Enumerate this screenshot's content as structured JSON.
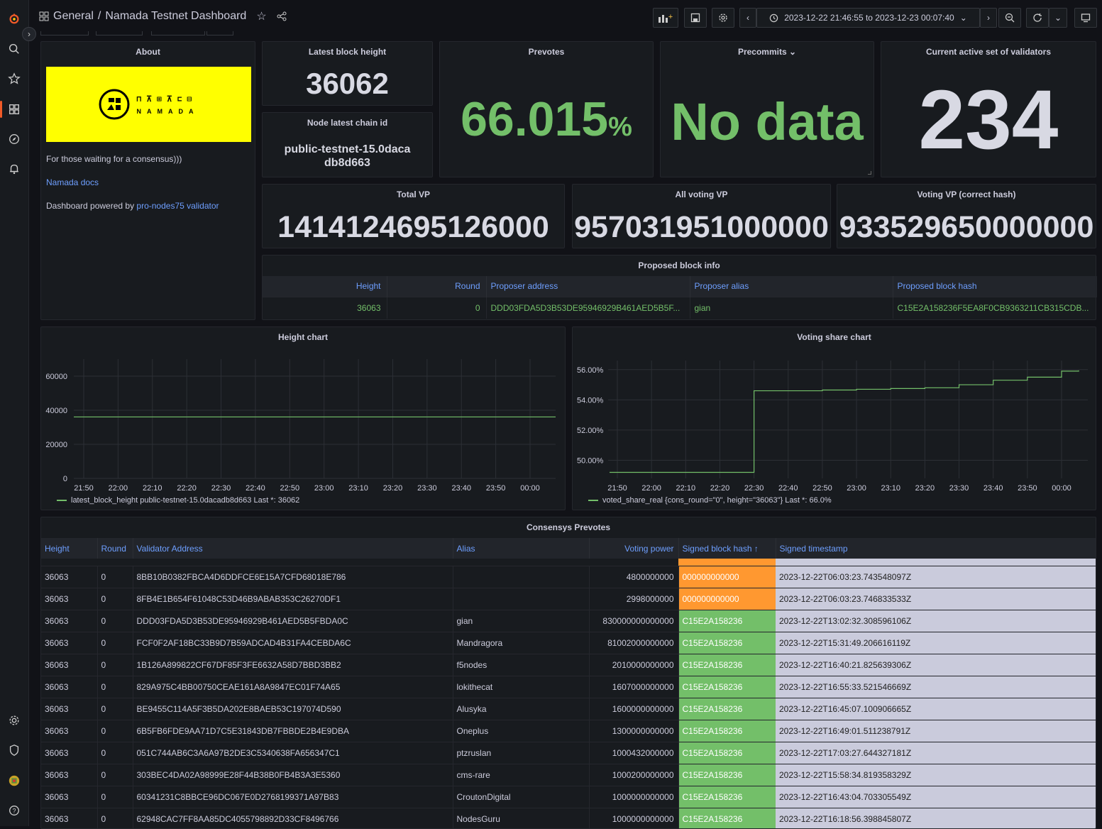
{
  "nav": {
    "breadcrumb_root": "General",
    "breadcrumb_sep": "/",
    "dashboard_title": "Namada Testnet Dashboard",
    "time_range": "2023-12-22 21:46:55 to 2023-12-23 00:07:40"
  },
  "about": {
    "title": "About",
    "logo_text": "NAMADA",
    "tagline": "For those waiting for a consensus)))",
    "docs_link": "Namada docs",
    "powered_prefix": "Dashboard powered by",
    "powered_link": "pro-nodes75 validator"
  },
  "stats": {
    "latest_block_title": "Latest block height",
    "latest_block_value": "36062",
    "chain_id_title": "Node latest chain id",
    "chain_id_value": "public-testnet-15.0dacadb8d663",
    "prevotes_title": "Prevotes",
    "prevotes_value": "66.015",
    "prevotes_unit": "%",
    "precommits_title": "Precommits",
    "precommits_value": "No data",
    "validators_title": "Current active set of validators",
    "validators_value": "234",
    "total_vp_title": "Total VP",
    "total_vp_value": "1414124695126000",
    "all_voting_title": "All voting VP",
    "all_voting_value": "957031951000000",
    "voting_correct_title": "Voting VP (correct hash)",
    "voting_correct_value": "933529650000000"
  },
  "proposed": {
    "title": "Proposed block info",
    "headers": [
      "Height",
      "Round",
      "Proposer address",
      "Proposer alias",
      "Proposed block hash"
    ],
    "row": [
      "36063",
      "0",
      "DDD03FDA5D3B53DE95946929B461AED5B5F...",
      "gian",
      "C15E2A158236F5EA8F0CB9363211CB315CDB..."
    ]
  },
  "height_chart": {
    "title": "Height chart",
    "legend": "latest_block_height public-testnet-15.0dacadb8d663  Last *: 36062"
  },
  "voting_chart": {
    "title": "Voting share chart",
    "legend": "voted_share_real {cons_round=\"0\", height=\"36063\"}  Last *: 66.0%"
  },
  "chart_data": [
    {
      "type": "line",
      "title": "Height chart",
      "xticks": [
        "21:50",
        "22:00",
        "22:10",
        "22:20",
        "22:30",
        "22:40",
        "22:50",
        "23:00",
        "23:10",
        "23:20",
        "23:30",
        "23:40",
        "23:50",
        "00:00"
      ],
      "yticks": [
        "0",
        "20000",
        "40000",
        "60000"
      ],
      "ylim": [
        0,
        70000
      ],
      "series": [
        {
          "name": "latest_block_height public-testnet-15.0dacadb8d663",
          "values": [
            36062,
            36062
          ]
        }
      ]
    },
    {
      "type": "line",
      "title": "Voting share chart",
      "xticks": [
        "21:50",
        "22:00",
        "22:10",
        "22:20",
        "22:30",
        "22:40",
        "22:50",
        "23:00",
        "23:10",
        "23:20",
        "23:30",
        "23:40",
        "23:50",
        "00:00"
      ],
      "yticks": [
        "50.00%",
        "52.00%",
        "54.00%",
        "56.00%"
      ],
      "ylim": [
        48.8,
        56.6
      ],
      "series": [
        {
          "name": "voted_share_real {cons_round=\"0\", height=\"36063\"}",
          "x": [
            "21:50",
            "22:00",
            "22:10",
            "22:20",
            "22:30",
            "22:30",
            "22:40",
            "22:50",
            "23:00",
            "23:10",
            "23:20",
            "23:30",
            "23:40",
            "23:50",
            "00:00",
            "00:05"
          ],
          "values": [
            49.2,
            49.2,
            49.2,
            49.2,
            49.2,
            54.6,
            54.6,
            54.65,
            54.7,
            54.75,
            54.8,
            55.0,
            55.3,
            55.5,
            55.9,
            55.95
          ]
        }
      ]
    }
  ],
  "consensus": {
    "title": "Consensys Prevotes",
    "headers": [
      "Height",
      "Round",
      "Validator Address",
      "Alias",
      "Voting power",
      "Signed block hash ↑",
      "Signed timestamp"
    ],
    "rows": [
      [
        "36063",
        "0",
        "8BB10B0382FBCA4D6DDFCE6E15A7CFD68018E786",
        "",
        "4800000000",
        "000000000000",
        "2023-12-22T06:03:23.743548097Z"
      ],
      [
        "36063",
        "0",
        "8FB4E1B654F61048C53D46B9ABAB353C26270DF1",
        "",
        "2998000000",
        "000000000000",
        "2023-12-22T06:03:23.746833533Z"
      ],
      [
        "36063",
        "0",
        "DDD03FDA5D3B53DE95946929B461AED5B5FBDA0C",
        "gian",
        "830000000000000",
        "C15E2A158236",
        "2023-12-22T13:02:32.308596106Z"
      ],
      [
        "36063",
        "0",
        "FCF0F2AF18BC33B9D7B59ADCAD4B31FA4CEBDA6C",
        "Mandragora",
        "81002000000000",
        "C15E2A158236",
        "2023-12-22T15:31:49.206616119Z"
      ],
      [
        "36063",
        "0",
        "1B126A899822CF67DF85F3FE6632A58D7BBD3BB2",
        "f5nodes",
        "2010000000000",
        "C15E2A158236",
        "2023-12-22T16:40:21.825639306Z"
      ],
      [
        "36063",
        "0",
        "829A975C4BB00750CEAE161A8A9847EC01F74A65",
        "lokithecat",
        "1607000000000",
        "C15E2A158236",
        "2023-12-22T16:55:33.521546669Z"
      ],
      [
        "36063",
        "0",
        "BE9455C114A5F3B5DA202E8BAEB53C197074D590",
        "Alusyka",
        "1600000000000",
        "C15E2A158236",
        "2023-12-22T16:45:07.100906665Z"
      ],
      [
        "36063",
        "0",
        "6B5FB6FDE9AA71D7C5E31843DB7FBBDE2B4E9DBA",
        "Oneplus",
        "1300000000000",
        "C15E2A158236",
        "2023-12-22T16:49:01.511238791Z"
      ],
      [
        "36063",
        "0",
        "051C744AB6C3A6A97B2DE3C5340638FA656347C1",
        "ptzruslan",
        "1000432000000",
        "C15E2A158236",
        "2023-12-22T17:03:27.644327181Z"
      ],
      [
        "36063",
        "0",
        "303BEC4DA02A98999E28F44B38B0FB4B3A3E5360",
        "cms-rare",
        "1000200000000",
        "C15E2A158236",
        "2023-12-22T15:58:34.819358329Z"
      ],
      [
        "36063",
        "0",
        "60341231C8BBCE96DC067E0D2768199371A97B83",
        "CroutonDigital",
        "1000000000000",
        "C15E2A158236",
        "2023-12-22T16:43:04.703305549Z"
      ],
      [
        "36063",
        "0",
        "62948CAC7FF8AA85DC4055798892D33CF8496766",
        "NodesGuru",
        "1000000000000",
        "C15E2A158236",
        "2023-12-22T16:18:56.398845807Z"
      ]
    ]
  },
  "colors": {
    "accent": "#6e9fff",
    "green": "#73bf69",
    "orange": "#ff9830",
    "lavender": "#cacbdc",
    "logo_bg": "#ffff00"
  }
}
